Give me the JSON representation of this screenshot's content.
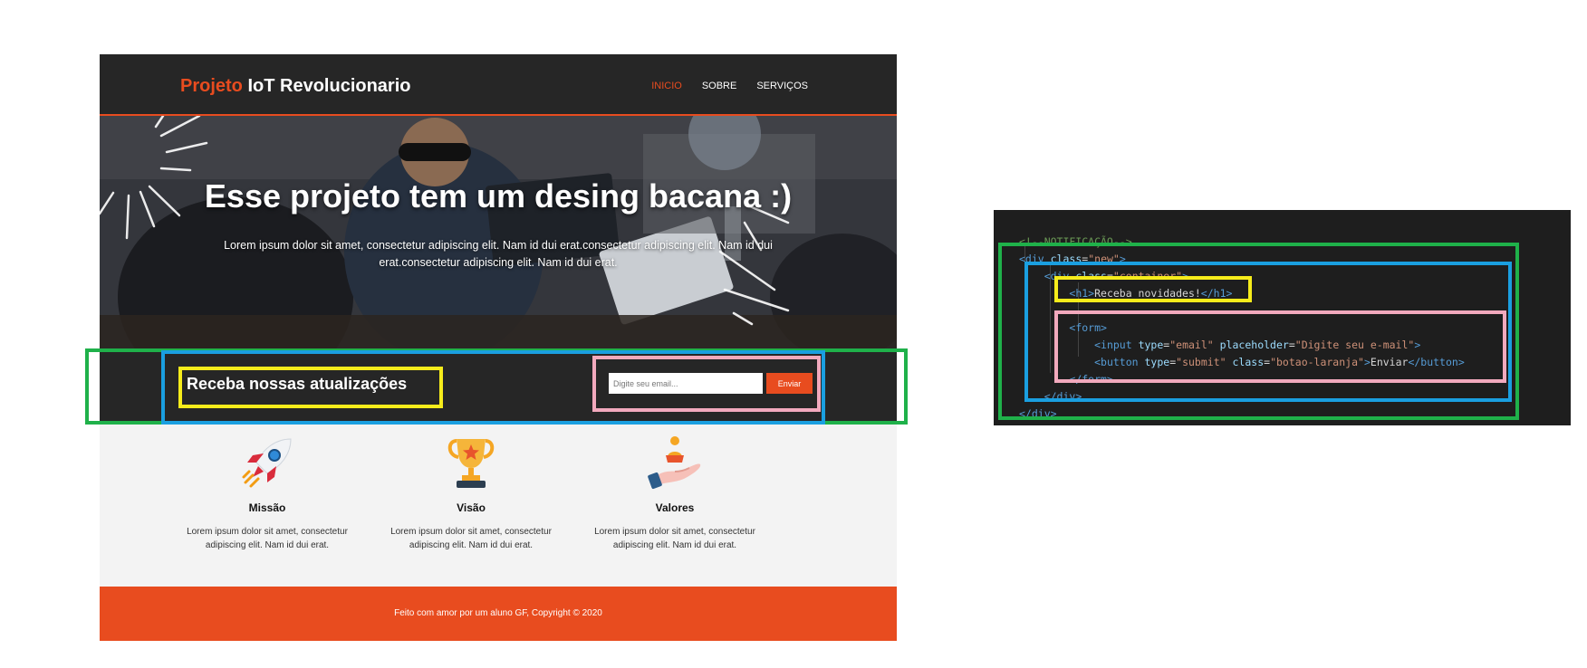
{
  "site": {
    "brand_accent": "Projeto",
    "brand_rest": " IoT Revolucionario",
    "nav": [
      {
        "label": "INICIO",
        "active": true
      },
      {
        "label": "SOBRE",
        "active": false
      },
      {
        "label": "SERVIÇOS",
        "active": false
      }
    ],
    "hero": {
      "title": "Esse projeto tem um desing bacana :)",
      "text": "Lorem ipsum dolor sit amet, consectetur adipiscing elit. Nam id dui erat.consectetur adipiscing elit. Nam id dui erat.consectetur adipiscing elit. Nam id dui erat."
    },
    "newsletter": {
      "title": "Receba nossas atualizações",
      "input_placeholder": "Digite seu email...",
      "button_label": "Enviar"
    },
    "features": [
      {
        "icon": "rocket-icon",
        "title": "Missão",
        "text": "Lorem ipsum dolor sit amet, consectetur adipiscing elit. Nam id dui erat."
      },
      {
        "icon": "trophy-icon",
        "title": "Visão",
        "text": "Lorem ipsum dolor sit amet, consectetur adipiscing elit. Nam id dui erat."
      },
      {
        "icon": "hand-person-icon",
        "title": "Valores",
        "text": "Lorem ipsum dolor sit amet, consectetur adipiscing elit. Nam id dui erat."
      }
    ],
    "footer": "Feito com amor por um aluno GF, Copyright © 2020"
  },
  "code": {
    "comment": "<!--NOTIFICAÇÃO-->",
    "outer_class": "new",
    "container_class": "container",
    "h1_text": "Receba novidades!",
    "input_type": "email",
    "input_placeholder": "Digite seu e-mail",
    "button_type": "submit",
    "button_class": "botao-laranja",
    "button_text": "Enviar"
  },
  "colors": {
    "accent": "#e84c1f",
    "dark": "#262626",
    "annot_green": "#1fb14a",
    "annot_blue": "#1a9fe0",
    "annot_yellow": "#f6ec1b",
    "annot_pink": "#f2a9bd"
  }
}
